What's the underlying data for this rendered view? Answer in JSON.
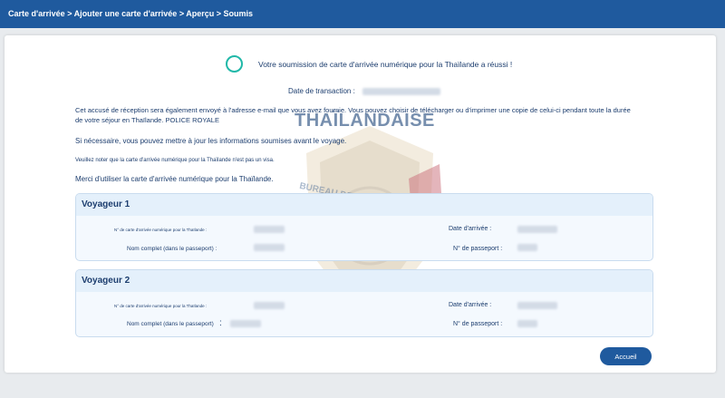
{
  "breadcrumb": {
    "items": [
      "Carte d'arrivée",
      "Ajouter une carte d'arrivée",
      "Aperçu",
      "Soumis"
    ],
    "separator": " > "
  },
  "watermark": {
    "title": "THAÏLANDAISE",
    "subtitle": "BUREAU DE L'IMMIGRATION"
  },
  "success": {
    "message": "Votre soumission de carte d'arrivée numérique pour la Thaïlande a réussi !"
  },
  "transaction": {
    "label": "Date de transaction :"
  },
  "paragraphs": {
    "receipt": "Cet accusé de réception sera également envoyé à l'adresse e-mail que vous avez fournie. Vous pouvez choisir de télécharger ou d'imprimer une copie de celui-ci pendant toute la durée de votre séjour en Thaïlande. POLICE ROYALE",
    "update": "Si nécessaire, vous pouvez mettre à jour les informations soumises avant le voyage.",
    "visa_note": "Veuillez noter que la carte d'arrivée numérique pour la Thaïlande n'est pas un visa.",
    "thanks": "Merci d'utiliser la carte d'arrivée numérique pour la Thaïlande."
  },
  "travelers": [
    {
      "title": "Voyageur 1",
      "card_number_label": "N° de carte d'arrivée numérique pour la Thaïlande :",
      "arrival_date_label": "Date d'arrivée :",
      "full_name_label": "Nom complet (dans le passeport) :",
      "passport_label": "N° de passeport :"
    },
    {
      "title": "Voyageur 2",
      "card_number_label": "N° de carte d'arrivée numérique pour la Thaïlande :",
      "arrival_date_label": "Date d'arrivée :",
      "full_name_label": "Nom complet (dans le passeport)",
      "full_name_colon": ":",
      "passport_label": "N° de passeport :"
    }
  ],
  "actions": {
    "home_label": "Accueil"
  },
  "colors": {
    "header": "#1f5a9e",
    "text": "#1c3d6e",
    "success_ring": "#20b8a8",
    "panel_border": "#c9dcef"
  }
}
